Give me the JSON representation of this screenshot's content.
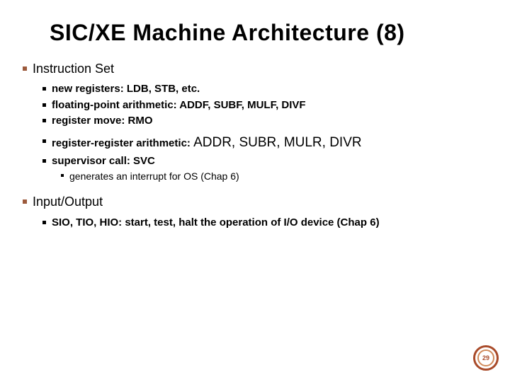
{
  "title": "SIC/XE Machine Architecture (8)",
  "sections": [
    {
      "heading": "Instruction Set",
      "items": [
        {
          "text": "new registers: LDB, STB, etc."
        },
        {
          "text": "floating-point arithmetic: ADDF, SUBF, MULF, DIVF"
        },
        {
          "text": "register move: RMO"
        },
        {
          "text_prefix": "register-register arithmetic: ",
          "text_big": "ADDR, SUBR, MULR, DIVR"
        },
        {
          "text": "supervisor call: SVC",
          "sub": [
            {
              "text": "generates an interrupt for OS (Chap 6)"
            }
          ]
        }
      ]
    },
    {
      "heading": "Input/Output",
      "items": [
        {
          "text": "SIO, TIO, HIO: start, test, halt the operation of I/O device (Chap 6)"
        }
      ]
    }
  ],
  "page_number": "29"
}
